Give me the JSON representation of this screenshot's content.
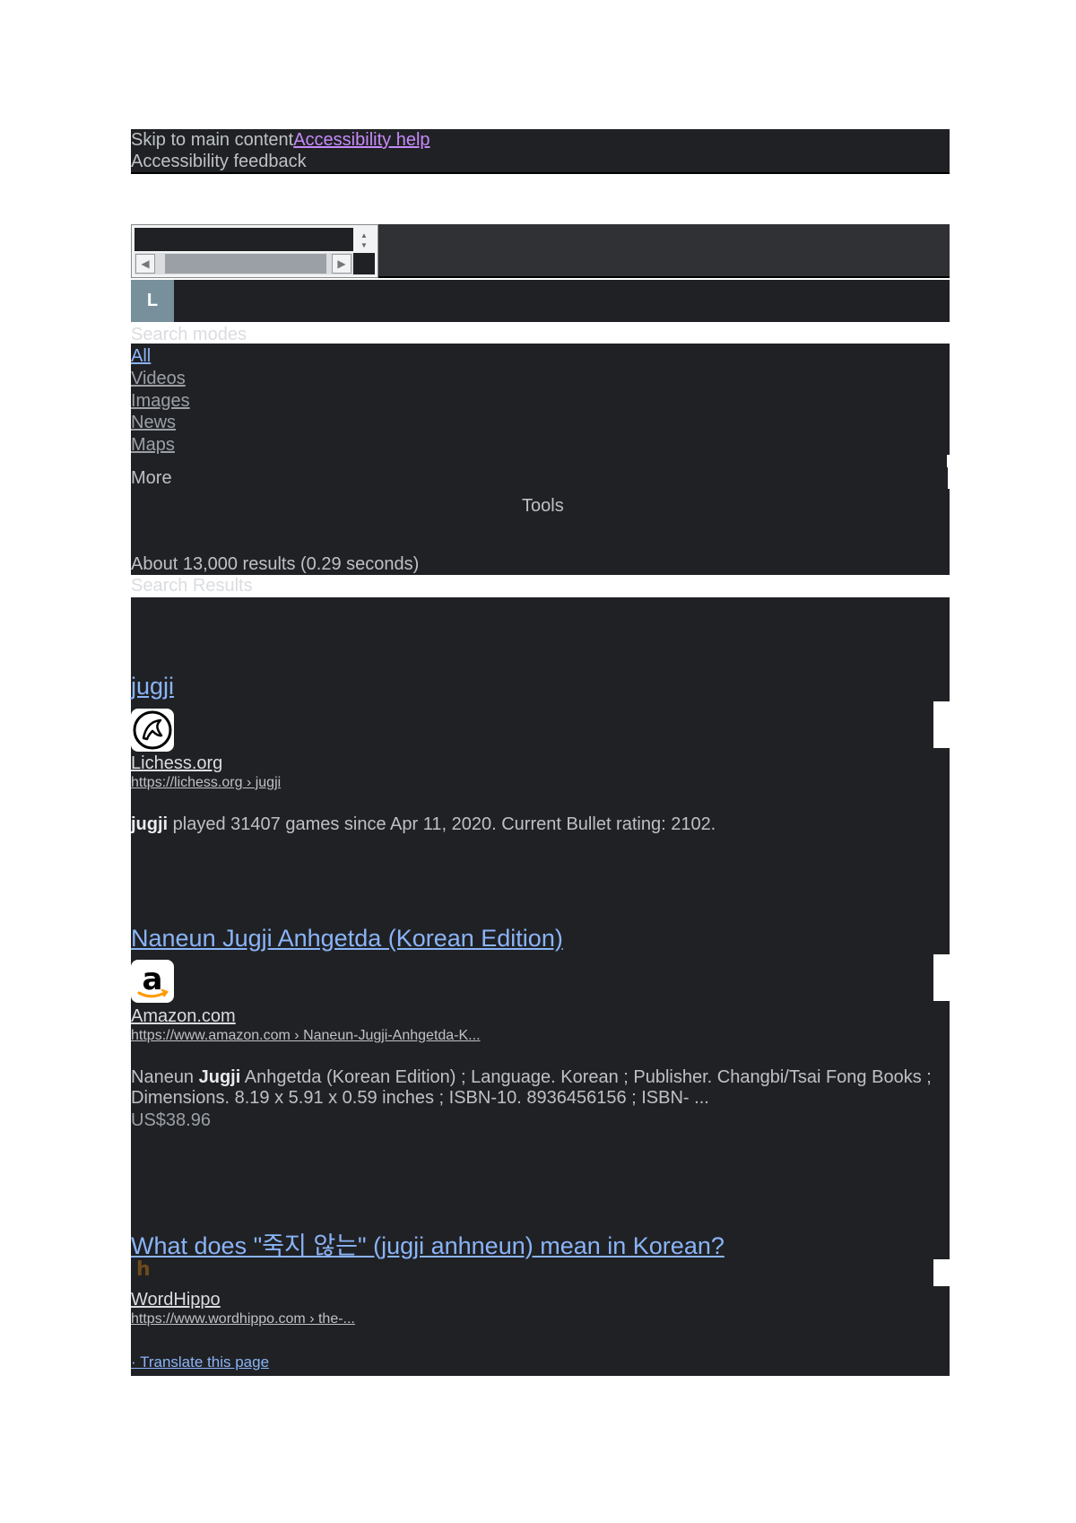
{
  "skip_links": {
    "skip_main": "Skip to main content",
    "accessibility_help": "Accessibility help",
    "accessibility_feedback": "Accessibility feedback"
  },
  "account": {
    "avatar_letter": "L"
  },
  "search_modes": {
    "heading": "Search modes",
    "tabs": [
      {
        "label": "All",
        "active": true
      },
      {
        "label": "Videos",
        "active": false
      },
      {
        "label": "Images",
        "active": false
      },
      {
        "label": "News",
        "active": false
      },
      {
        "label": "Maps",
        "active": false
      }
    ],
    "more": "More",
    "tools": "Tools"
  },
  "result_stats": "About 13,000 results (0.29 seconds)",
  "results_heading": "Search Results",
  "results": [
    {
      "title": "jugji",
      "icon": "lichess-knight-icon",
      "site": "Lichess.org",
      "url": "https://lichess.org › jugji",
      "snippet_bold": "jugji",
      "snippet_rest": " played 31407 games since Apr 11, 2020. Current Bullet rating: 2102."
    },
    {
      "title": "Naneun Jugji Anhgetda (Korean Edition)",
      "icon": "amazon-logo-icon",
      "site": "Amazon.com",
      "url": "https://www.amazon.com › Naneun-Jugji-Anhgetda-K...",
      "snippet_pre": "Naneun ",
      "snippet_bold": "Jugji",
      "snippet_rest": " Anhgetda (Korean Edition) ; Language. Korean ; Publisher. Changbi/Tsai Fong Books ; Dimensions. 8.19 x 5.91 x 0.59 inches ; ISBN-10. 8936456156 ; ISBN- ...",
      "price": "US$38.96"
    },
    {
      "title": "What does \"죽지 않는\" (jugji anhneun) mean in Korean?",
      "icon": "wordhippo-icon",
      "site": "WordHippo",
      "url": "https://www.wordhippo.com › the-...",
      "translate": "· Translate this page"
    }
  ],
  "colors": {
    "background": "#202124",
    "link": "#8ab4f8",
    "visited_link": "#c58af9",
    "text": "#bdc1c6"
  }
}
